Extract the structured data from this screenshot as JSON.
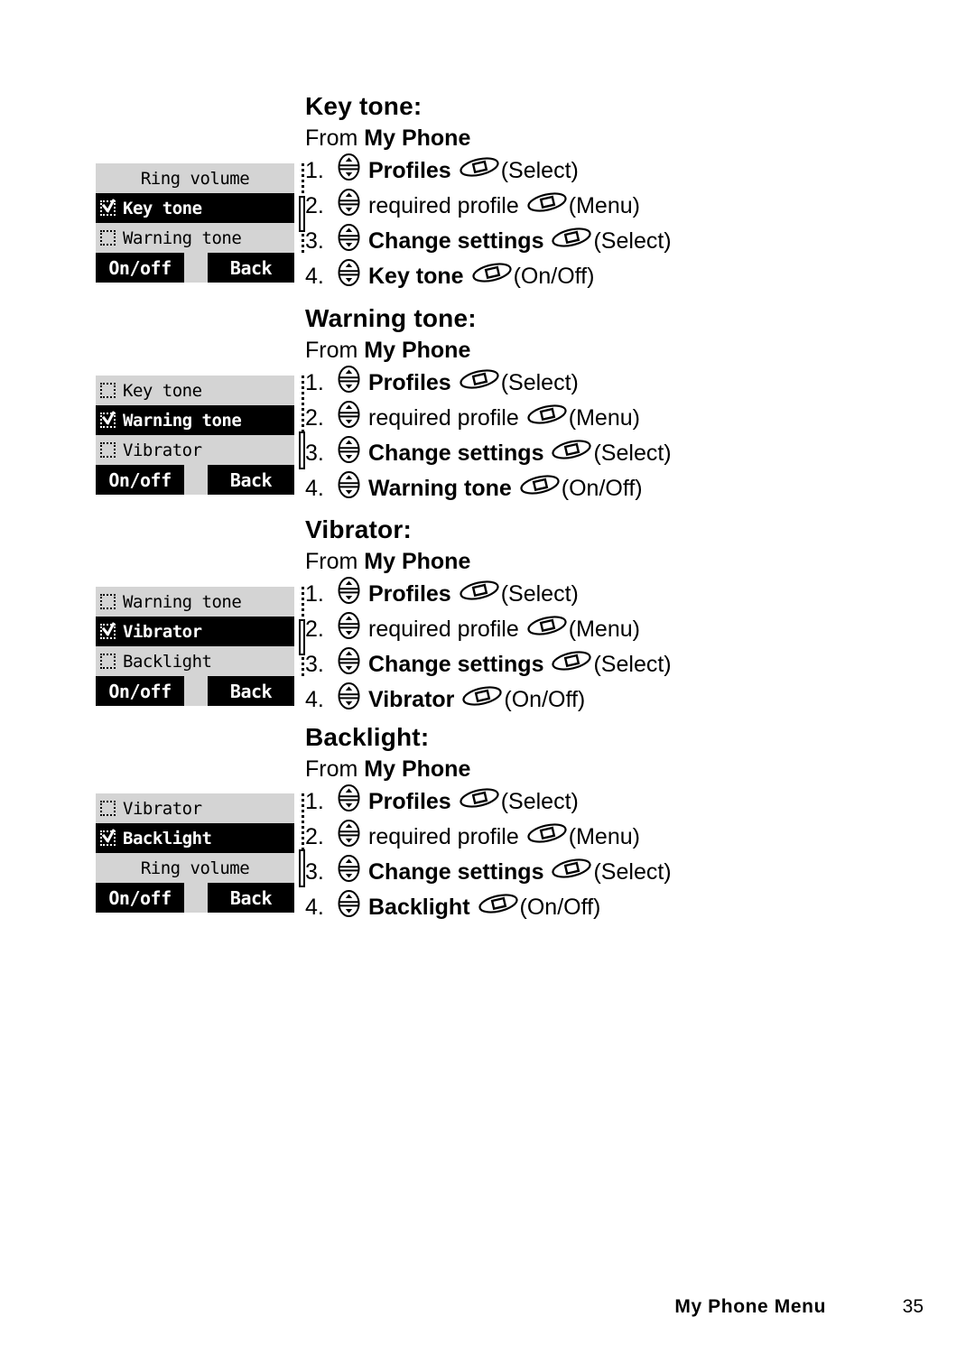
{
  "page": {
    "footer_title": "My Phone Menu",
    "page_number": "35"
  },
  "icons": {
    "nav_key": "navigation-key-icon",
    "soft_key": "soft-key-icon",
    "checkbox_checked": "checkbox-checked-icon",
    "checkbox_unchecked": "checkbox-unchecked-icon"
  },
  "colors": {
    "screen_background": "#d4d4d4",
    "screen_selected": "#000000",
    "text": "#000000",
    "page_background": "#ffffff"
  },
  "sections": [
    {
      "title": "Key tone:",
      "from_prefix": "From ",
      "from_target": "My Phone",
      "steps": [
        {
          "num": "1.",
          "label": "Profiles",
          "bold": true,
          "key": "(Select)"
        },
        {
          "num": "2.",
          "label": "required profile",
          "bold": false,
          "key": "(Menu)"
        },
        {
          "num": "3.",
          "label": "Change settings",
          "bold": true,
          "key": "(Select)"
        },
        {
          "num": "4.",
          "label": "Key tone",
          "bold": true,
          "key": "(On/Off)"
        }
      ],
      "screen": {
        "items": [
          {
            "text": "Ring volume",
            "checkbox": "none",
            "selected": false,
            "centered": true
          },
          {
            "text": "Key tone",
            "checkbox": "checked",
            "selected": true,
            "centered": false
          },
          {
            "text": "Warning tone",
            "checkbox": "unchecked",
            "selected": false,
            "centered": false
          }
        ],
        "softkeys": {
          "left": "On/off",
          "right": "Back"
        }
      }
    },
    {
      "title": "Warning tone:",
      "from_prefix": "From ",
      "from_target": "My Phone",
      "steps": [
        {
          "num": "1.",
          "label": "Profiles",
          "bold": true,
          "key": "(Select)"
        },
        {
          "num": "2.",
          "label": "required profile",
          "bold": false,
          "key": "(Menu)"
        },
        {
          "num": "3.",
          "label": "Change settings",
          "bold": true,
          "key": "(Select)"
        },
        {
          "num": "4.",
          "label": "Warning tone",
          "bold": true,
          "key": "(On/Off)"
        }
      ],
      "screen": {
        "items": [
          {
            "text": "Key tone",
            "checkbox": "unchecked",
            "selected": false,
            "centered": false
          },
          {
            "text": "Warning tone",
            "checkbox": "checked",
            "selected": true,
            "centered": false
          },
          {
            "text": "Vibrator",
            "checkbox": "unchecked",
            "selected": false,
            "centered": false
          }
        ],
        "softkeys": {
          "left": "On/off",
          "right": "Back"
        }
      }
    },
    {
      "title": "Vibrator:",
      "from_prefix": "From ",
      "from_target": "My Phone",
      "steps": [
        {
          "num": "1.",
          "label": "Profiles",
          "bold": true,
          "key": "(Select)"
        },
        {
          "num": "2.",
          "label": "required profile",
          "bold": false,
          "key": "(Menu)"
        },
        {
          "num": "3.",
          "label": "Change settings",
          "bold": true,
          "key": "(Select)"
        },
        {
          "num": "4.",
          "label": "Vibrator",
          "bold": true,
          "key": "(On/Off)"
        }
      ],
      "screen": {
        "items": [
          {
            "text": "Warning tone",
            "checkbox": "unchecked",
            "selected": false,
            "centered": false
          },
          {
            "text": "Vibrator",
            "checkbox": "checked",
            "selected": true,
            "centered": false
          },
          {
            "text": "Backlight",
            "checkbox": "unchecked",
            "selected": false,
            "centered": false
          }
        ],
        "softkeys": {
          "left": "On/off",
          "right": "Back"
        }
      }
    },
    {
      "title": "Backlight:",
      "from_prefix": "From ",
      "from_target": "My Phone",
      "steps": [
        {
          "num": "1.",
          "label": "Profiles",
          "bold": true,
          "key": "(Select)"
        },
        {
          "num": "2.",
          "label": "required profile",
          "bold": false,
          "key": "(Menu)"
        },
        {
          "num": "3.",
          "label": "Change settings",
          "bold": true,
          "key": "(Select)"
        },
        {
          "num": "4.",
          "label": "Backlight",
          "bold": true,
          "key": "(On/Off)"
        }
      ],
      "screen": {
        "items": [
          {
            "text": "Vibrator",
            "checkbox": "unchecked",
            "selected": false,
            "centered": false
          },
          {
            "text": "Backlight",
            "checkbox": "checked",
            "selected": true,
            "centered": false
          },
          {
            "text": "Ring volume",
            "checkbox": "none",
            "selected": false,
            "centered": true
          }
        ],
        "softkeys": {
          "left": "On/off",
          "right": "Back"
        }
      }
    }
  ]
}
